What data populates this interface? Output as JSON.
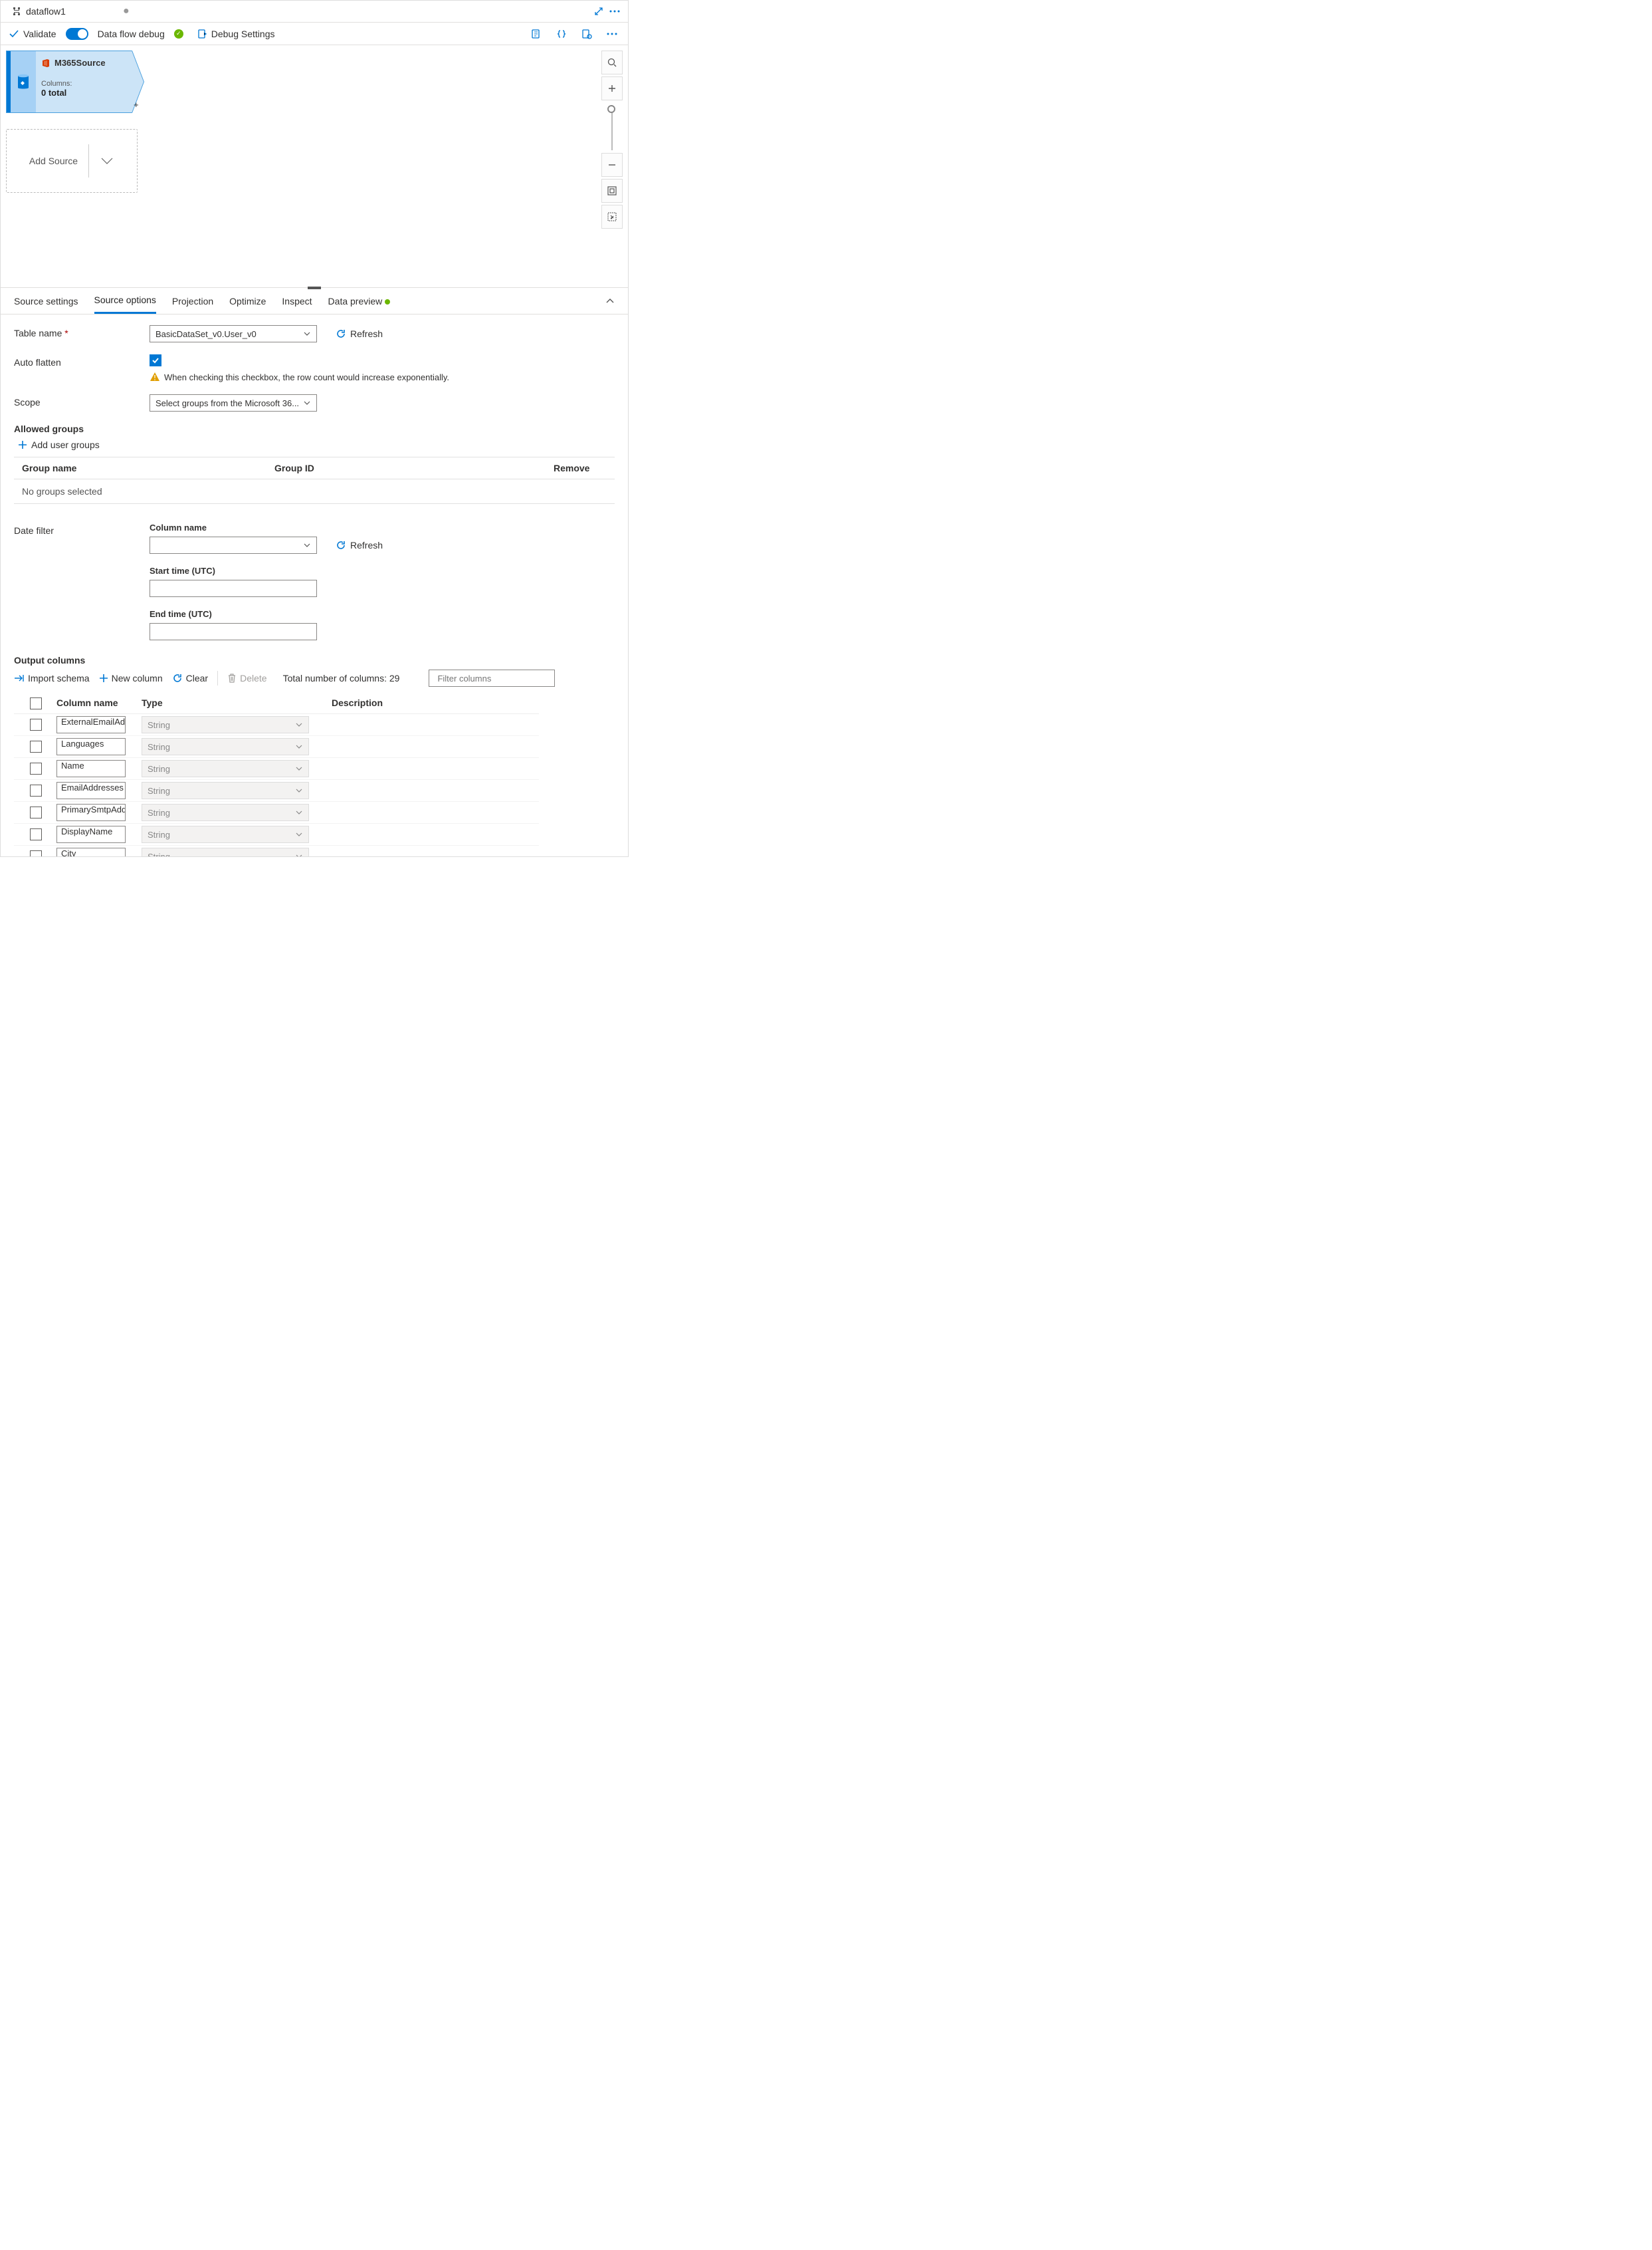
{
  "header": {
    "tab_name": "dataflow1"
  },
  "toolbar": {
    "validate": "Validate",
    "debug_toggle_label": "Data flow debug",
    "debug_settings": "Debug Settings"
  },
  "canvas": {
    "source_node": {
      "title": "M365Source",
      "columns_label": "Columns:",
      "columns_value": "0 total"
    },
    "add_source": "Add Source"
  },
  "tabs": {
    "source_settings": "Source settings",
    "source_options": "Source options",
    "projection": "Projection",
    "optimize": "Optimize",
    "inspect": "Inspect",
    "data_preview": "Data preview"
  },
  "form": {
    "table_name_label": "Table name",
    "table_name_value": "BasicDataSet_v0.User_v0",
    "refresh": "Refresh",
    "auto_flatten_label": "Auto flatten",
    "auto_flatten_warning": "When checking this checkbox, the row count would increase exponentially.",
    "scope_label": "Scope",
    "scope_value": "Select groups from the Microsoft 36...",
    "allowed_groups_label": "Allowed groups",
    "add_groups": "Add user groups",
    "groups_col_name": "Group name",
    "groups_col_id": "Group ID",
    "groups_col_remove": "Remove",
    "groups_empty": "No groups selected",
    "date_filter_label": "Date filter",
    "column_name_label": "Column name",
    "start_time_label": "Start time (UTC)",
    "end_time_label": "End time (UTC)"
  },
  "output": {
    "section_label": "Output columns",
    "import_schema": "Import schema",
    "new_column": "New column",
    "clear": "Clear",
    "delete": "Delete",
    "total_label": "Total number of columns: 29",
    "filter_placeholder": "Filter columns",
    "head_col": "Column name",
    "head_type": "Type",
    "head_desc": "Description",
    "rows": [
      {
        "name": "ExternalEmailAdd",
        "type": "String"
      },
      {
        "name": "Languages",
        "type": "String"
      },
      {
        "name": "Name",
        "type": "String"
      },
      {
        "name": "EmailAddresses",
        "type": "String"
      },
      {
        "name": "PrimarySmtpAddr",
        "type": "String"
      },
      {
        "name": "DisplayName",
        "type": "String"
      },
      {
        "name": "City",
        "type": "String"
      }
    ]
  }
}
